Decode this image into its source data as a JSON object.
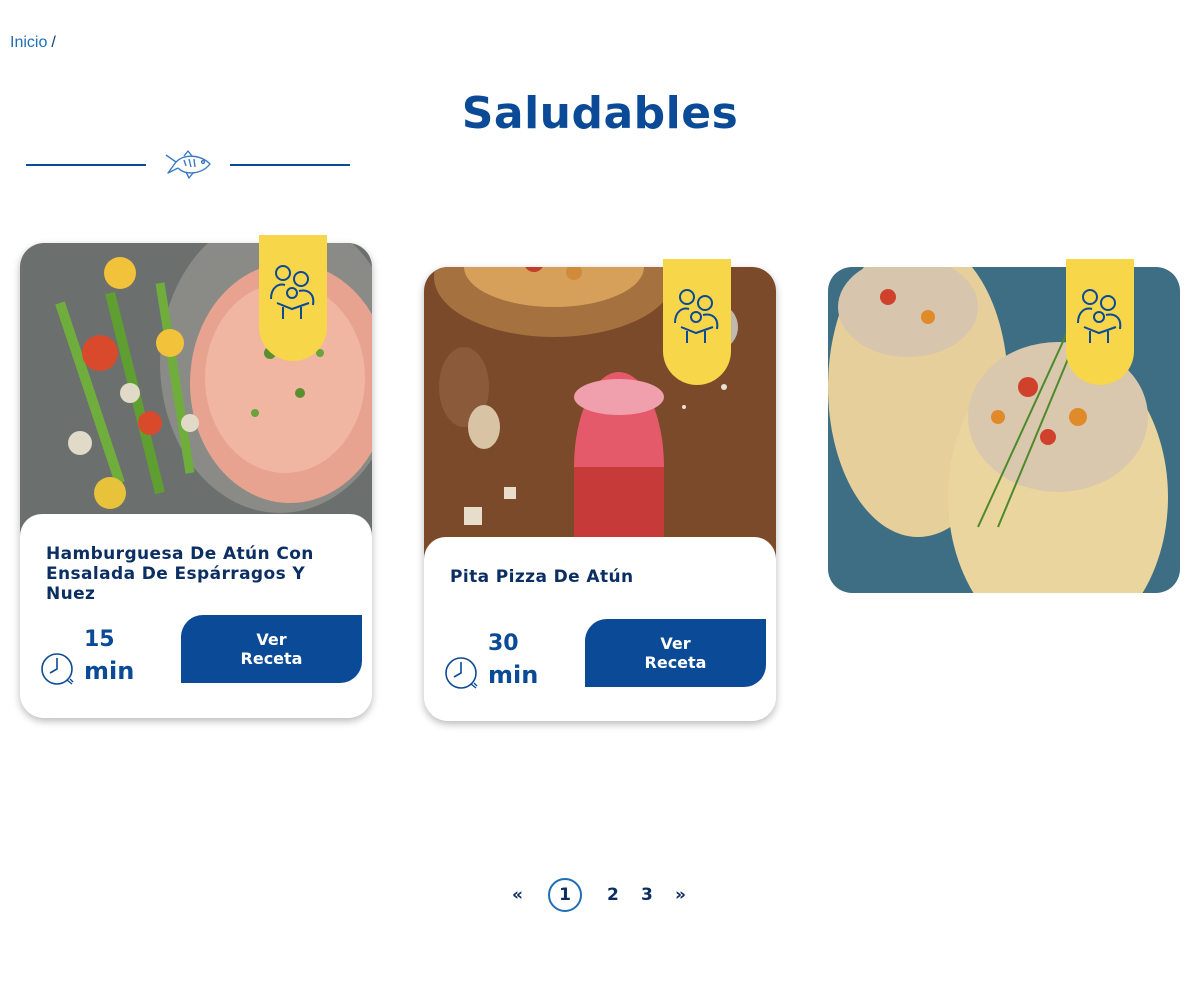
{
  "breadcrumb": {
    "home": "Inicio",
    "separator": "/"
  },
  "page": {
    "title": "Saludables"
  },
  "icons": {
    "divider": "fish-icon",
    "tag": "family-icon",
    "time": "clock-icon"
  },
  "colors": {
    "brand_blue": "#0b4a97",
    "accent_yellow": "#f7d64a",
    "link_blue": "#1e6fb8"
  },
  "recipes": [
    {
      "title": "Hamburguesa De Atún Con Ensalada De Espárragos Y Nuez",
      "time_value": "15",
      "time_unit": "min",
      "button": "Ver Receta"
    },
    {
      "title": "Pita Pizza De Atún",
      "time_value": "30",
      "time_unit": "min",
      "button": "Ver Receta"
    },
    {
      "title": "",
      "time_value": "",
      "time_unit": "",
      "button": ""
    }
  ],
  "pagination": {
    "prev": "«",
    "pages": [
      "1",
      "2",
      "3"
    ],
    "current": "1",
    "next": "»"
  }
}
